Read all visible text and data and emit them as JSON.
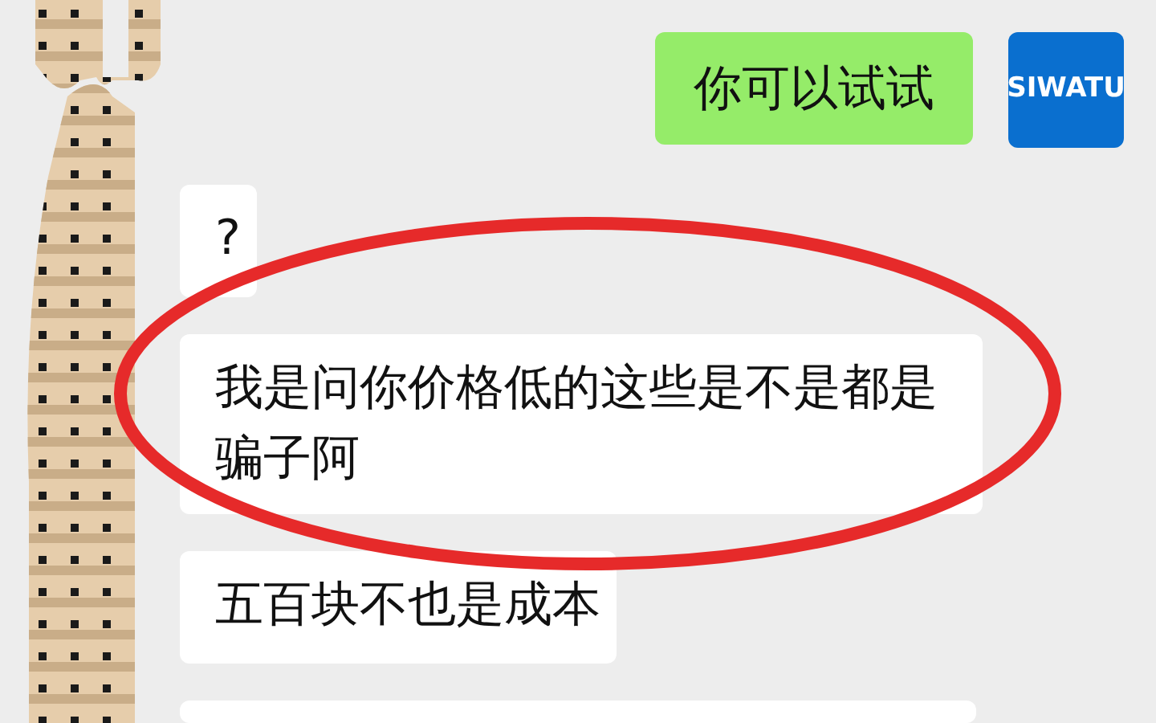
{
  "messages": [
    {
      "kind": "outgoing",
      "text": "你可以试试",
      "avatar": "SIWATU"
    },
    {
      "kind": "incoming",
      "text": "?"
    },
    {
      "kind": "incoming",
      "text": "我是问你价格低的这些是不是都是骗子阿"
    },
    {
      "kind": "incoming",
      "text": "五百块不也是成本"
    },
    {
      "kind": "incoming"
    }
  ]
}
